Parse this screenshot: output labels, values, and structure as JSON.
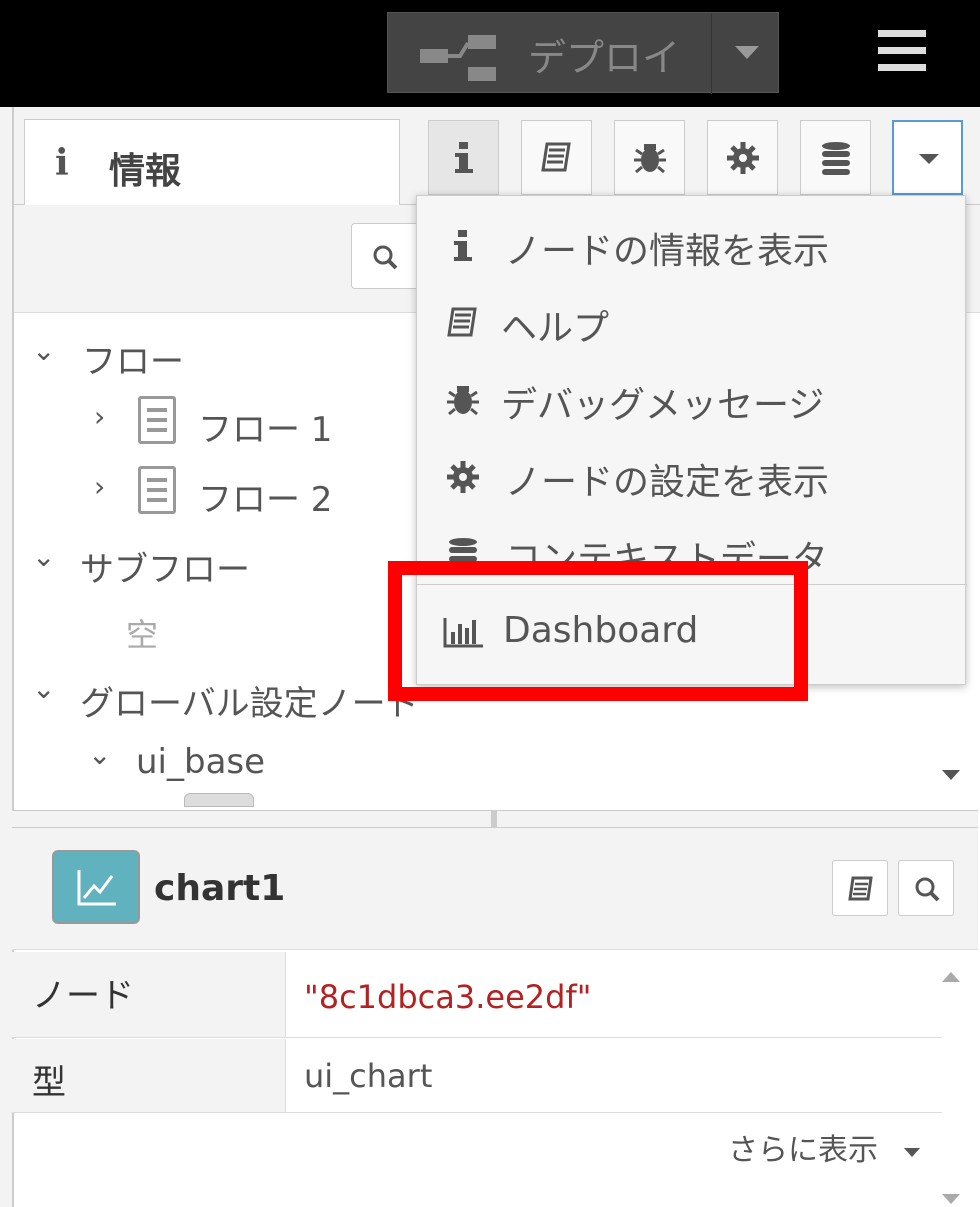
{
  "header": {
    "deploy_label": "デプロイ"
  },
  "sidebar": {
    "tab_info_label": "情報",
    "tab_info_icon": "i",
    "tab_buttons": [
      "info-icon",
      "book-icon",
      "bug-icon",
      "gear-icon",
      "database-icon",
      "caret-down-icon"
    ]
  },
  "tree": {
    "flows_label": "フロー",
    "flow_items": [
      "フロー 1",
      "フロー 2"
    ],
    "subflows_label": "サブフロー",
    "subflows_empty": "空",
    "global_config_label": "グローバル設定ノード",
    "ui_base_label": "ui_base"
  },
  "dropdown": {
    "items": [
      {
        "icon": "info-icon",
        "label": "ノードの情報を表示"
      },
      {
        "icon": "book-icon",
        "label": "ヘルプ"
      },
      {
        "icon": "bug-icon",
        "label": "デバッグメッセージ"
      },
      {
        "icon": "gear-icon",
        "label": "ノードの設定を表示"
      },
      {
        "icon": "database-icon",
        "label": "コンテキストデータ"
      },
      {
        "icon": "bar-chart-icon",
        "label": "Dashboard"
      }
    ]
  },
  "node": {
    "name": "chart1",
    "props": [
      {
        "key": "ノード",
        "value": "\"8c1dbca3.ee2df\""
      },
      {
        "key": "型",
        "value": "ui_chart"
      }
    ],
    "more_label": "さらに表示"
  },
  "colors": {
    "header_bg": "#000000",
    "highlight": "#ff0000",
    "node_icon": "#5fb2be",
    "id_text": "#b22222"
  }
}
